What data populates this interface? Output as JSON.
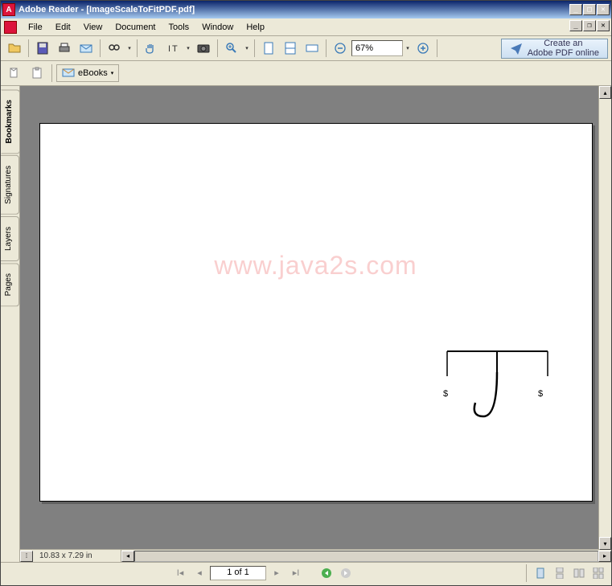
{
  "title": "Adobe Reader - [ImageScaleToFitPDF.pdf]",
  "menu": [
    "File",
    "Edit",
    "View",
    "Document",
    "Tools",
    "Window",
    "Help"
  ],
  "zoom": "67%",
  "createpdf_line1": "Create an",
  "createpdf_line2": "Adobe PDF online",
  "ebooks": "eBooks",
  "tabs": [
    "Bookmarks",
    "Signatures",
    "Layers",
    "Pages"
  ],
  "dimensions": "10.83 x 7.29 in",
  "page_of": "1 of 1",
  "watermark": "www.java2s.com"
}
